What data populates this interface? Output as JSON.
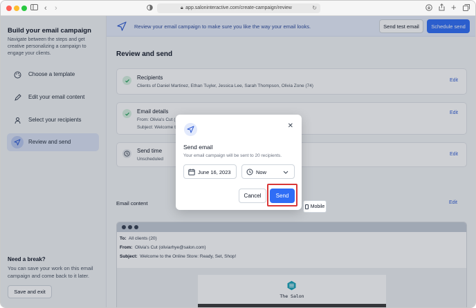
{
  "browser": {
    "url": "app.saloninteractive.com/create-campaign/review",
    "traffic_colors": {
      "close": "#fe5f57",
      "minimize": "#febc2e",
      "zoom": "#28c840"
    }
  },
  "sidebar": {
    "title": "Build your email campaign",
    "description": "Navigate between the steps and get creative personalizing a campaign to engage your clients.",
    "steps": [
      {
        "label": "Choose a template",
        "icon": "palette-icon"
      },
      {
        "label": "Edit your email content",
        "icon": "pencil-icon"
      },
      {
        "label": "Select your recipients",
        "icon": "users-icon"
      },
      {
        "label": "Review and send",
        "icon": "send-icon",
        "active": true
      }
    ],
    "break_title": "Need a break?",
    "break_text": "You can save your work on this email campaign and come back to it later.",
    "save_exit_label": "Save and exit"
  },
  "banner": {
    "text": "Review your email campaign to make sure you like the way your email looks.",
    "send_test_label": "Send test email",
    "schedule_label": "Schedule send"
  },
  "main": {
    "heading": "Review and send",
    "recipients": {
      "title": "Recipients",
      "detail": "Clients of Daniel Martinez, Ethan Tuyler, Jessica Lee, Sarah Thompson, Olivia Zone (74)",
      "edit_label": "Edit"
    },
    "email_details": {
      "title": "Email details",
      "from": "From: Olivia's Cut (",
      "subject": "Subject: Welcome t",
      "edit_label": "Edit"
    },
    "send_time": {
      "title": "Send time",
      "detail": "Unscheduled",
      "edit_label": "Edit"
    },
    "email_content_label": "Email content",
    "email_content_edit": "Edit",
    "mobile_label": "Mobile",
    "preview": {
      "to_label": "To:",
      "to_value": "All clients (20)",
      "from_label": "From:",
      "from_value": "Olivia's Cut (oliviarhye@salon.com)",
      "subject_label": "Subject:",
      "subject_value": "Welcome to the Online Store: Ready, Set, Shop!",
      "salon_name": "The Salon"
    }
  },
  "modal": {
    "title": "Send email",
    "subtitle": "Your email campaign will be sent to 20 recipients.",
    "date_value": "June 16, 2023",
    "time_value": "Now",
    "cancel_label": "Cancel",
    "send_label": "Send"
  },
  "colors": {
    "accent": "#2f6df6",
    "success": "#22a35a",
    "highlight": "#d93636"
  }
}
